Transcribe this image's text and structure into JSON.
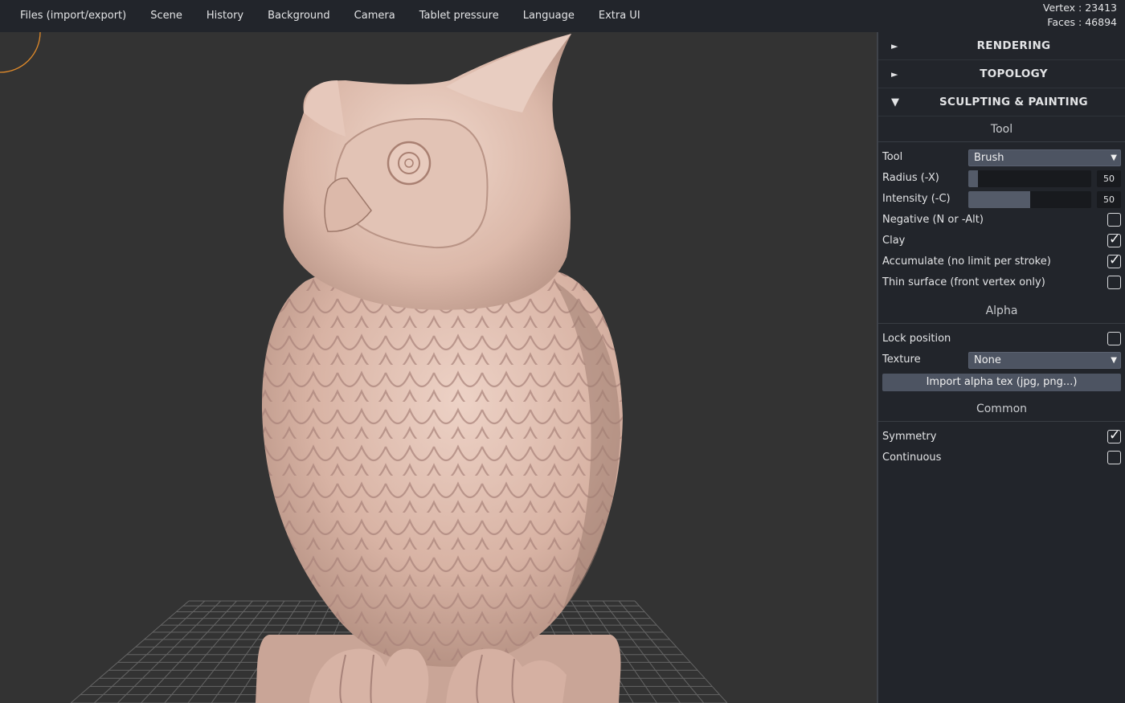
{
  "menu": {
    "items": [
      "Files (import/export)",
      "Scene",
      "History",
      "Background",
      "Camera",
      "Tablet pressure",
      "Language",
      "Extra UI"
    ],
    "stats": {
      "vertex": "Vertex : 23413",
      "faces": "Faces : 46894"
    }
  },
  "panel": {
    "sections": {
      "rendering": "RENDERING",
      "topology": "TOPOLOGY",
      "sculpting": "SCULPTING & PAINTING"
    },
    "arrows": {
      "collapsed": "►",
      "expanded": "▼"
    },
    "tool": {
      "title": "Tool",
      "tool_label": "Tool",
      "tool_value": "Brush",
      "radius_label": "Radius (-X)",
      "radius_value": "50",
      "radius_fraction": 0.08,
      "intensity_label": "Intensity (-C)",
      "intensity_value": "50",
      "intensity_fraction": 0.5,
      "checks": [
        {
          "label": "Negative (N or -Alt)",
          "checked": false
        },
        {
          "label": "Clay",
          "checked": true
        },
        {
          "label": "Accumulate (no limit per stroke)",
          "checked": true
        },
        {
          "label": "Thin surface (front vertex only)",
          "checked": false
        }
      ]
    },
    "alpha": {
      "title": "Alpha",
      "lock_label": "Lock position",
      "lock_checked": false,
      "texture_label": "Texture",
      "texture_value": "None",
      "import_label": "Import alpha tex (jpg, png...)"
    },
    "common": {
      "title": "Common",
      "symmetry_label": "Symmetry",
      "symmetry_checked": true,
      "continuous_label": "Continuous",
      "continuous_checked": false
    },
    "check_glyph": "✓"
  },
  "colors": {
    "background": "#333333",
    "panel": "#22252b",
    "model": "#d6b1a3",
    "brush_cursor": "#e08a2a",
    "grid": "#6b6b6b"
  }
}
